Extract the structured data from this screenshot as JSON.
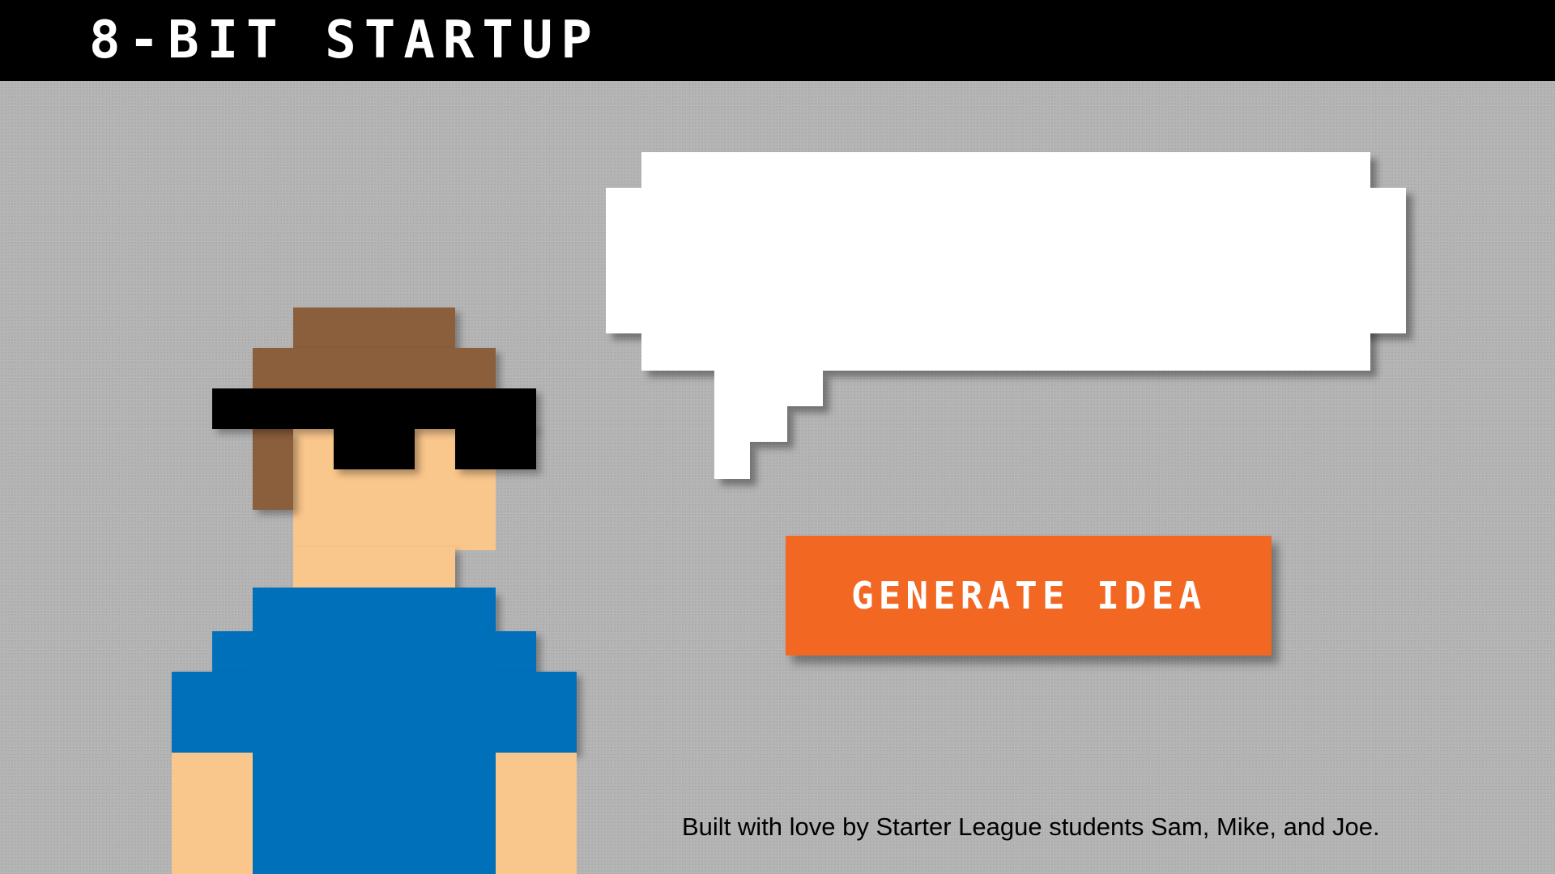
{
  "header": {
    "title": "8-BIT STARTUP"
  },
  "speech_bubble": {
    "text": ""
  },
  "generate_button": {
    "label": "GENERATE IDEA"
  },
  "footer": {
    "credit": "Built with love by Starter League students Sam, Mike, and Joe."
  },
  "colors": {
    "topbar": "#000000",
    "background": "#b3b3b3",
    "button": "#f26722",
    "hair": "#8b5e3c",
    "skin": "#f9c68b",
    "shirt": "#0070bb",
    "sunglasses": "#000000",
    "bubble": "#ffffff"
  }
}
